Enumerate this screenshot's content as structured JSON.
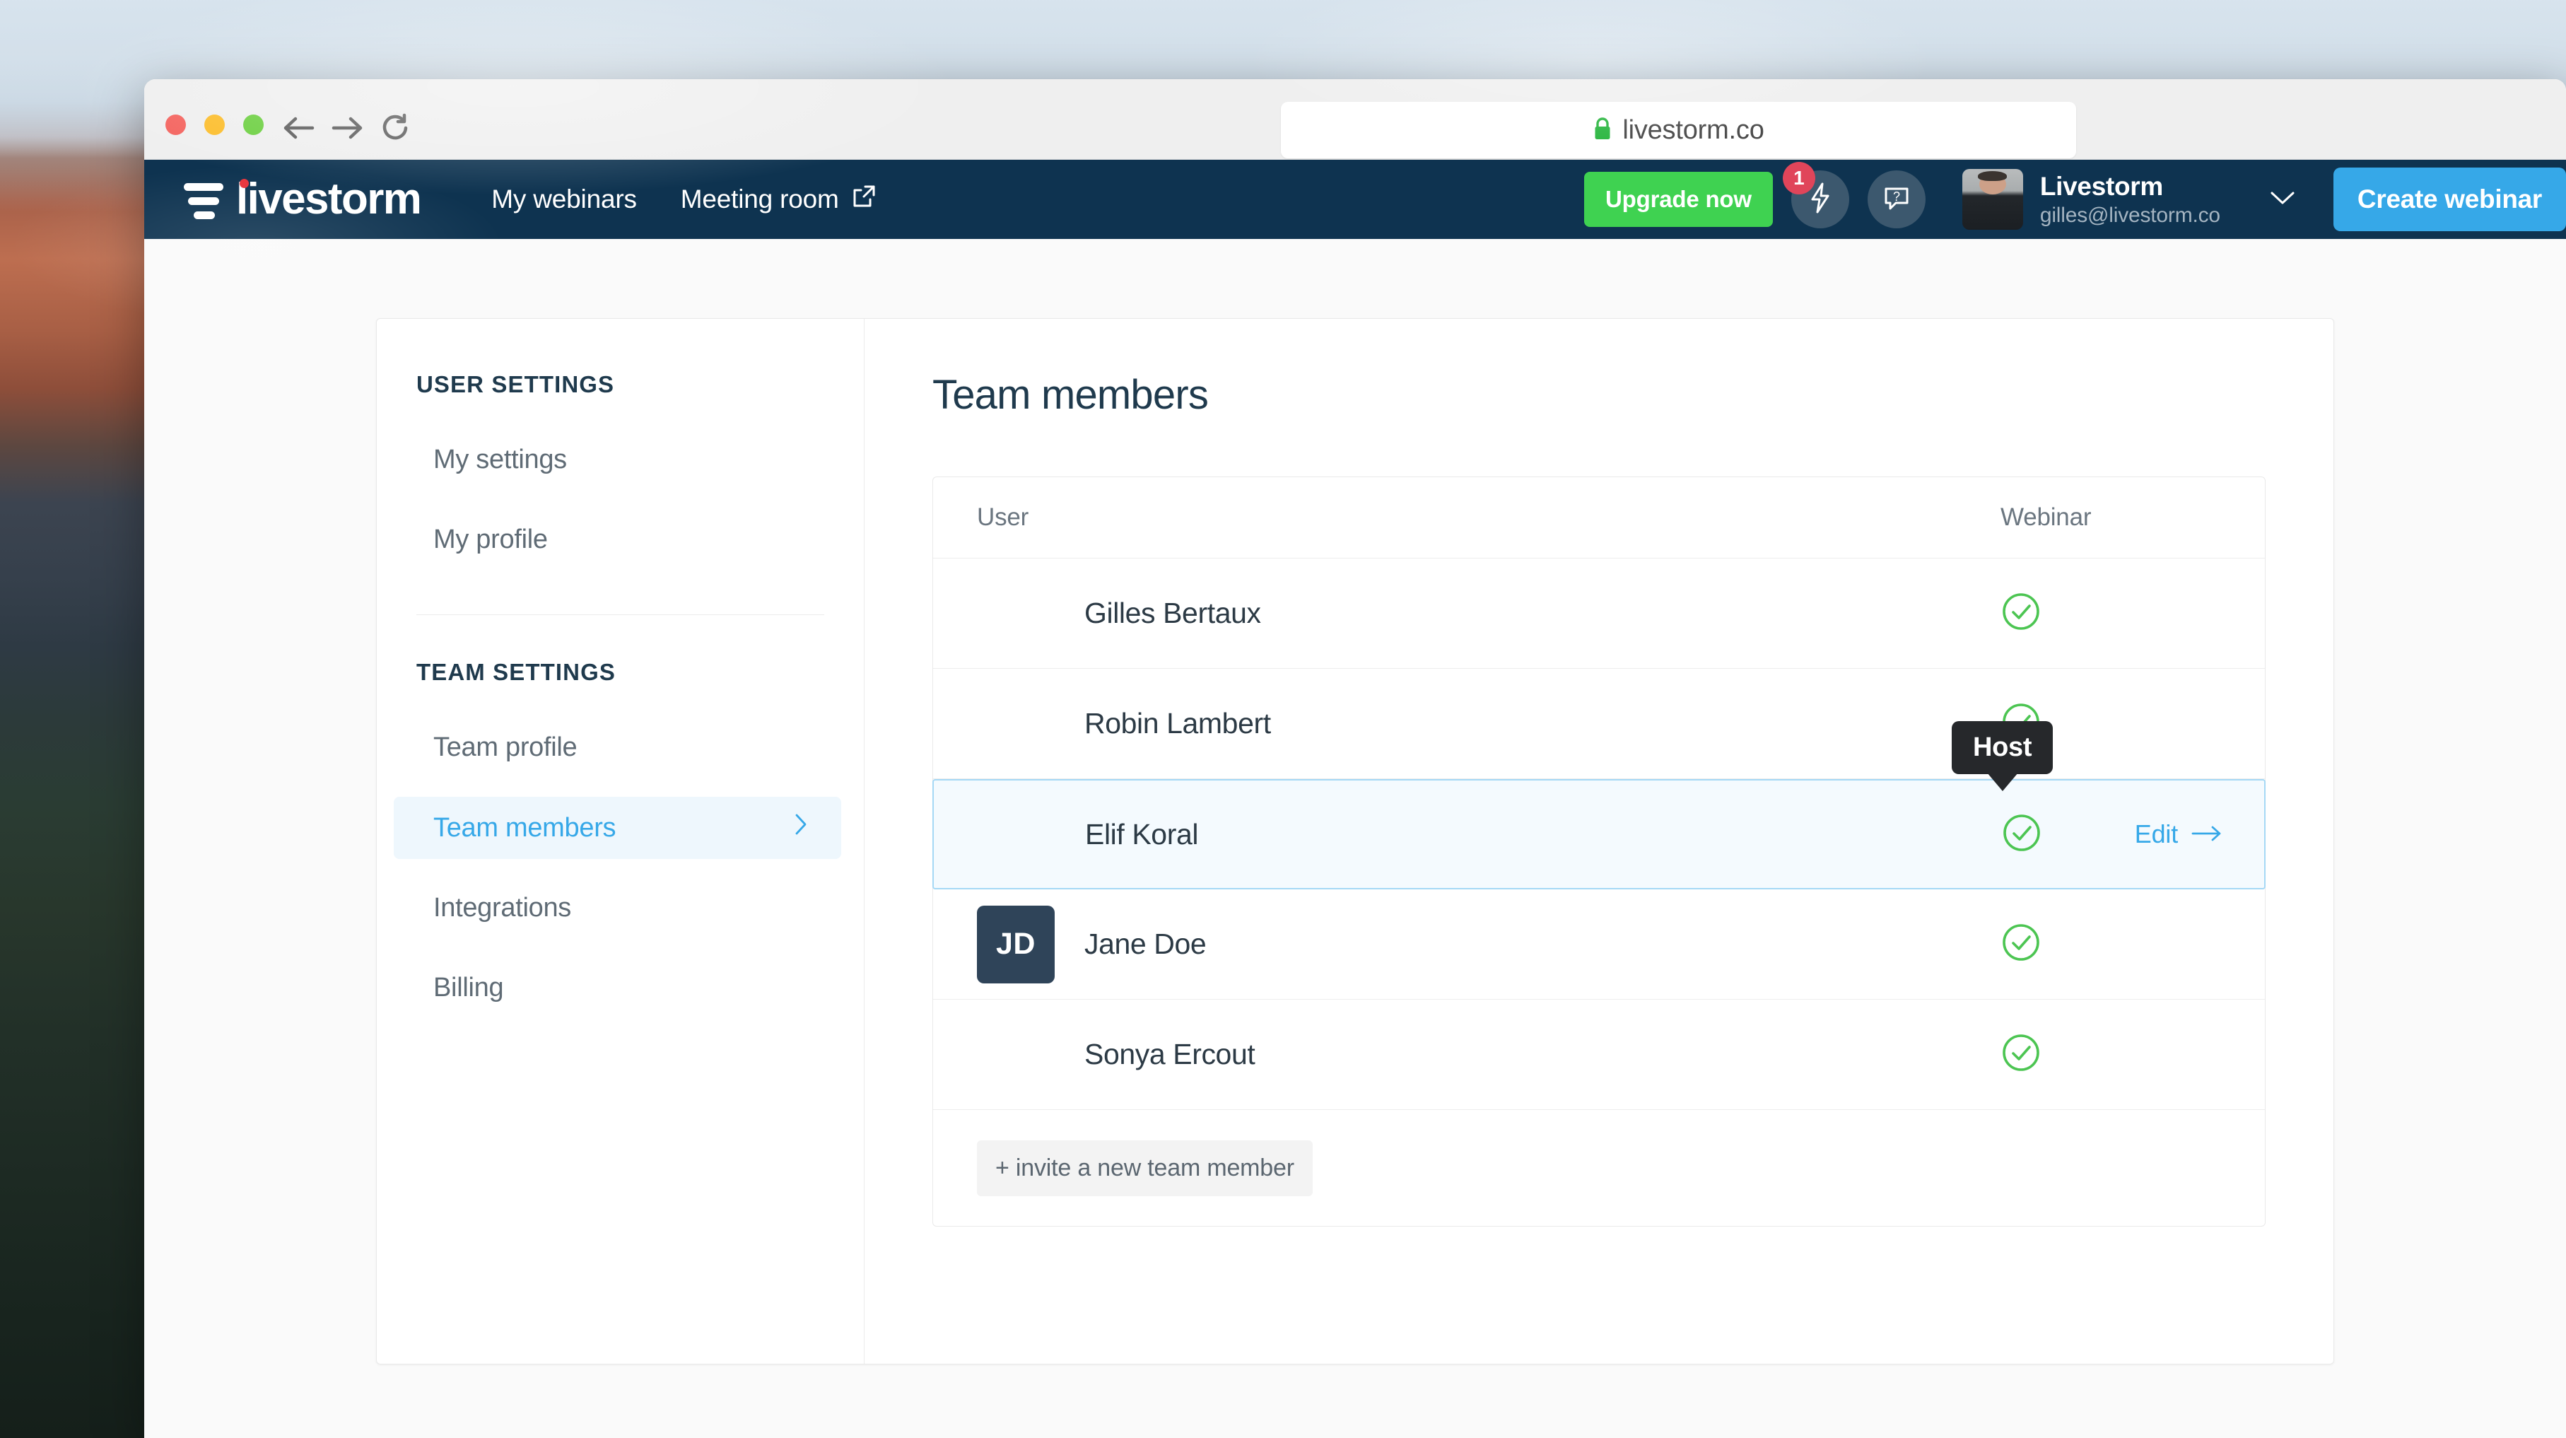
{
  "browser": {
    "url": "livestorm.co",
    "lock_icon": "lock-icon",
    "back_icon": "back-arrow-icon",
    "forward_icon": "forward-arrow-icon",
    "reload_icon": "reload-icon",
    "traffic": {
      "close": "close-button",
      "minimize": "minimize-button",
      "maximize": "maximize-button"
    }
  },
  "navbar": {
    "brand": "livestorm",
    "links": [
      {
        "label": "My webinars",
        "icon": null
      },
      {
        "label": "Meeting room",
        "icon": "external-link-icon"
      }
    ],
    "upgrade_label": "Upgrade now",
    "notifications_badge": "1",
    "bolt_icon": "lightning-bolt-icon",
    "help_icon": "help-question-icon",
    "account": {
      "name": "Livestorm",
      "email": "gilles@livestorm.co",
      "chevron": "chevron-down-icon"
    },
    "create_label": "Create webinar",
    "colors": {
      "navy": "#0e3350",
      "green": "#3fd251",
      "blue": "#36a8e8",
      "badge_red": "#e0455a"
    }
  },
  "sidebar": {
    "groups": [
      {
        "title": "USER SETTINGS",
        "items": [
          {
            "label": "My settings",
            "active": false
          },
          {
            "label": "My profile",
            "active": false
          }
        ]
      },
      {
        "title": "TEAM SETTINGS",
        "items": [
          {
            "label": "Team profile",
            "active": false
          },
          {
            "label": "Team members",
            "active": true,
            "chevron": "chevron-right-icon"
          },
          {
            "label": "Integrations",
            "active": false
          },
          {
            "label": "Billing",
            "active": false
          }
        ]
      }
    ]
  },
  "main": {
    "title": "Team members",
    "table": {
      "columns": [
        "User",
        "Webinar"
      ],
      "rows": [
        {
          "name": "Gilles Bertaux",
          "avatar_kind": "photo",
          "avatar_class": "av-g",
          "webinar": true,
          "selected": false,
          "edit_label": null
        },
        {
          "name": "Robin Lambert",
          "avatar_kind": "photo",
          "avatar_class": "av-r",
          "webinar": true,
          "selected": false,
          "edit_label": null
        },
        {
          "name": "Elif Koral",
          "avatar_kind": "photo",
          "avatar_class": "av-e",
          "webinar": true,
          "selected": true,
          "edit_label": "Edit"
        },
        {
          "name": "Jane Doe",
          "avatar_kind": "initials",
          "initials": "JD",
          "webinar": true,
          "selected": false,
          "edit_label": null
        },
        {
          "name": "Sonya Ercout",
          "avatar_kind": "photo",
          "avatar_class": "av-s",
          "webinar": true,
          "selected": false,
          "edit_label": null
        }
      ],
      "invite_label": "+ invite a new team member",
      "check_icon": "check-circle-icon",
      "check_color": "#4CC552"
    },
    "tooltip": {
      "text": "Host",
      "anchor_row": "Elif Koral"
    }
  }
}
